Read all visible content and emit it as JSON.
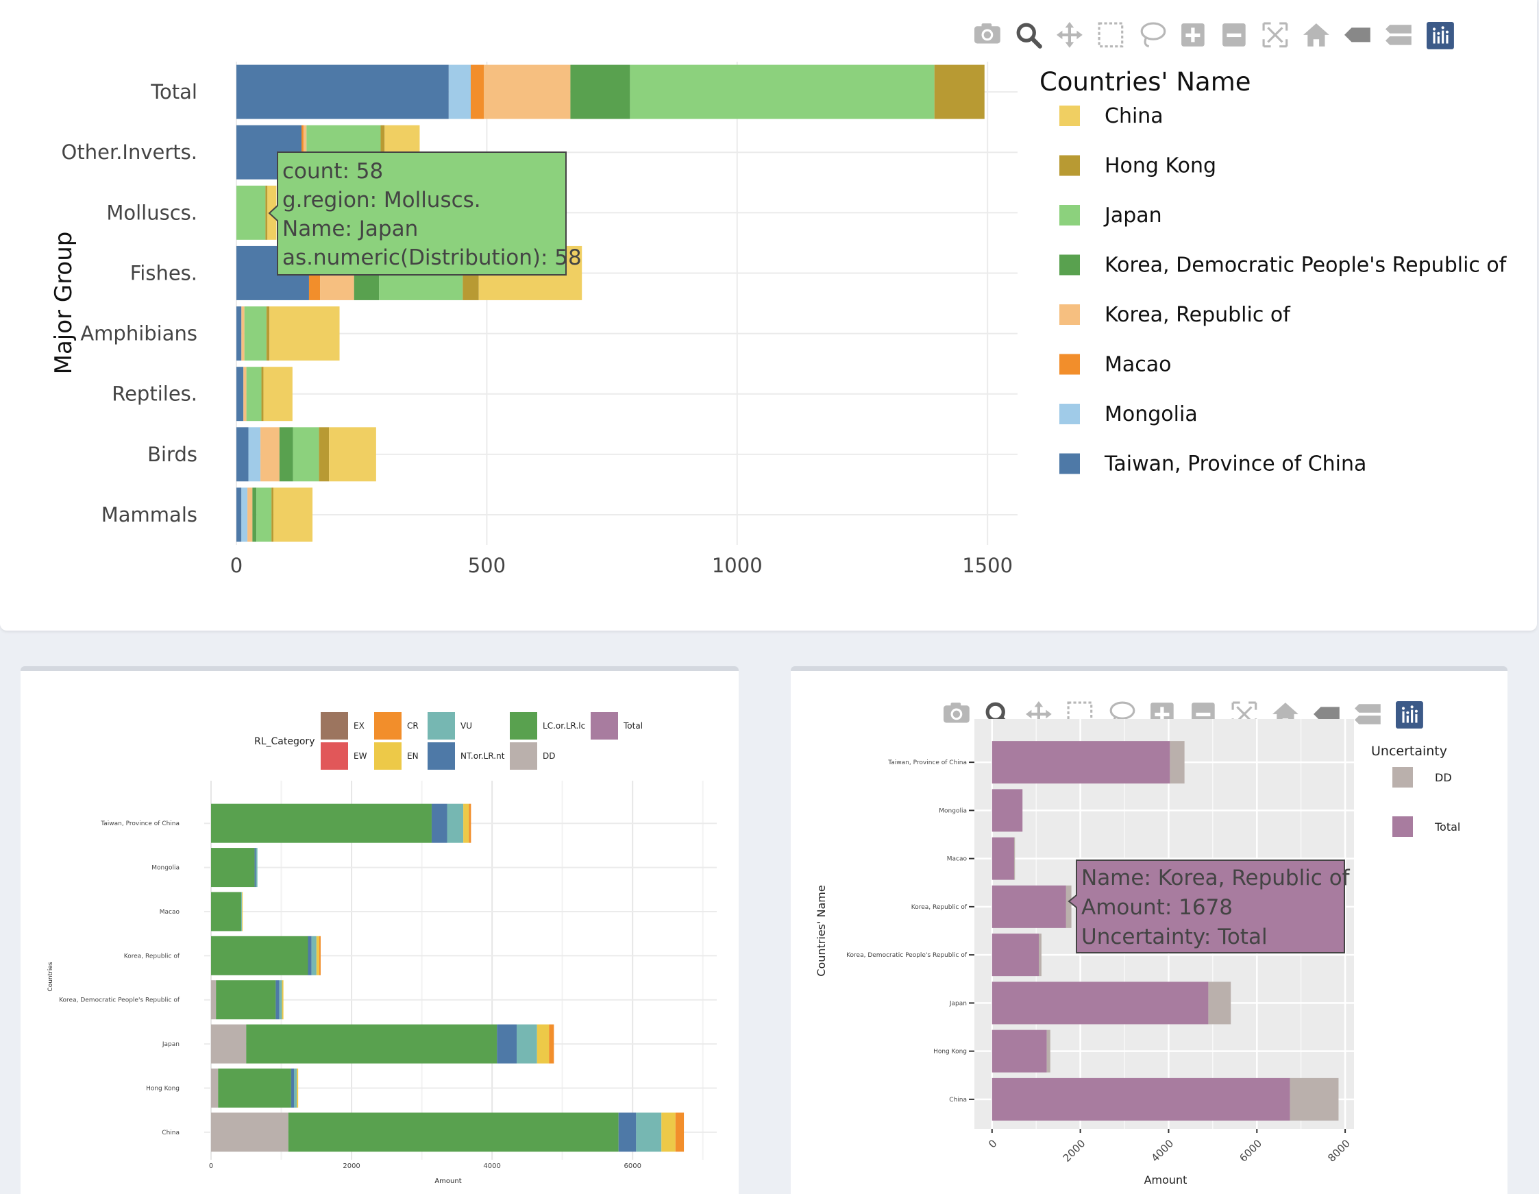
{
  "colors": {
    "China": "#f0cf62",
    "Hong Kong": "#b89a33",
    "Japan": "#8cd17d",
    "Korea, Democratic People's Republic of": "#59a14f",
    "Korea, Republic of": "#f6bf80",
    "Macao": "#f28e2b",
    "Mongolia": "#a0cbe8",
    "Taiwan, Province of China": "#4e79a7",
    "EX": "#9c755f",
    "EW": "#e15759",
    "CR": "#f28e2b",
    "EN": "#edc948",
    "VU": "#76b7b2",
    "NT.or.LR.nt": "#4e79a7",
    "LC.or.LR.lc": "#59a14f",
    "DD": "#bab0ac",
    "Total": "#a87c9f"
  },
  "toolbar_icons": [
    "camera-icon",
    "zoom-icon",
    "pan-icon",
    "box-select-icon",
    "lasso-icon",
    "zoom-in-icon",
    "zoom-out-icon",
    "autoscale-icon",
    "reset-axes-icon",
    "hover-closest-icon",
    "hover-compare-icon",
    "plotly-logo-icon"
  ],
  "chart_data": [
    {
      "type": "bar",
      "orientation": "horizontal",
      "stacked": true,
      "ylabel": "Major Group",
      "xlabel": "",
      "xlim": [
        0,
        1560
      ],
      "xticks": [
        0,
        500,
        1000,
        1500
      ],
      "categories": [
        "Total",
        "Other.Inverts.",
        "Molluscs.",
        "Fishes.",
        "Amphibians",
        "Reptiles.",
        "Birds",
        "Mammals"
      ],
      "legend": {
        "title": "Countries' Name",
        "position": "right"
      },
      "series": [
        {
          "name": "Taiwan, Province of China",
          "values": [
            424,
            130,
            0,
            145,
            10,
            14,
            24,
            10
          ]
        },
        {
          "name": "Mongolia",
          "values": [
            44,
            0,
            0,
            0,
            0,
            0,
            24,
            12
          ]
        },
        {
          "name": "Macao",
          "values": [
            26,
            4,
            0,
            22,
            0,
            0,
            0,
            0
          ]
        },
        {
          "name": "Korea, Republic of",
          "values": [
            173,
            6,
            0,
            68,
            6,
            6,
            38,
            10
          ]
        },
        {
          "name": "Korea, Democratic People's Republic of",
          "values": [
            119,
            0,
            0,
            50,
            0,
            0,
            27,
            8
          ]
        },
        {
          "name": "Japan",
          "values": [
            608,
            148,
            58,
            167,
            44,
            30,
            52,
            30
          ]
        },
        {
          "name": "Hong Kong",
          "values": [
            100,
            8,
            4,
            32,
            6,
            4,
            20,
            4
          ]
        },
        {
          "name": "China",
          "values": [
            0,
            70,
            18,
            206,
            140,
            58,
            94,
            78
          ]
        }
      ],
      "tooltip": {
        "lines": [
          "count:  58",
          "g.region: Molluscs.",
          "Name: Japan",
          "as.numeric(Distribution):  58"
        ]
      }
    },
    {
      "type": "bar",
      "orientation": "horizontal",
      "stacked": true,
      "xlabel": "Amount",
      "ylabel": "Countries",
      "xlim": [
        0,
        7100
      ],
      "xticks": [
        0,
        2000,
        4000,
        6000
      ],
      "categories": [
        "Taiwan, Province of China",
        "Mongolia",
        "Macao",
        "Korea, Republic of",
        "Korea, Democratic People's Republic of",
        "Japan",
        "Hong Kong",
        "China"
      ],
      "legend": {
        "title": "RL_Category",
        "position": "top"
      },
      "series": [
        {
          "name": "DD",
          "values": [
            0,
            0,
            0,
            0,
            70,
            500,
            100,
            1100
          ]
        },
        {
          "name": "LC.or.LR.lc",
          "values": [
            3140,
            620,
            430,
            1380,
            850,
            3570,
            1040,
            4700
          ]
        },
        {
          "name": "NT.or.LR.nt",
          "values": [
            220,
            20,
            0,
            50,
            50,
            280,
            40,
            250
          ]
        },
        {
          "name": "VU",
          "values": [
            230,
            20,
            10,
            70,
            40,
            290,
            40,
            360
          ]
        },
        {
          "name": "EN",
          "values": [
            80,
            0,
            10,
            40,
            20,
            170,
            20,
            200
          ]
        },
        {
          "name": "CR",
          "values": [
            30,
            0,
            0,
            20,
            0,
            70,
            0,
            120
          ]
        },
        {
          "name": "EW",
          "values": [
            0,
            0,
            0,
            0,
            0,
            0,
            0,
            0
          ]
        },
        {
          "name": "EX",
          "values": [
            0,
            0,
            0,
            0,
            0,
            0,
            0,
            0
          ]
        },
        {
          "name": "Total",
          "values": [
            0,
            0,
            0,
            0,
            0,
            0,
            0,
            0
          ]
        }
      ],
      "legend_order": [
        "EX",
        "EW",
        "CR",
        "EN",
        "VU",
        "NT.or.LR.nt",
        "LC.or.LR.lc",
        "DD",
        "Total"
      ]
    },
    {
      "type": "bar",
      "orientation": "horizontal",
      "stacked": true,
      "xlabel": "Amount",
      "ylabel": "Countries' Name",
      "xlim": [
        -400,
        8200
      ],
      "xticks": [
        0,
        2000,
        4000,
        6000,
        8000
      ],
      "categories": [
        "Taiwan, Province of China",
        "Mongolia",
        "Macao",
        "Korea, Republic of",
        "Korea, Democratic People's Republic of",
        "Japan",
        "Hong Kong",
        "China"
      ],
      "legend": {
        "title": "Uncertainty",
        "position": "right"
      },
      "series": [
        {
          "name": "Total",
          "values": [
            4030,
            690,
            500,
            1678,
            1060,
            4900,
            1240,
            6750
          ]
        },
        {
          "name": "DD",
          "values": [
            330,
            0,
            20,
            120,
            60,
            510,
            80,
            1100
          ]
        }
      ],
      "tooltip": {
        "lines": [
          "Name: Korea, Republic of",
          "Amount: 1678",
          "Uncertainty: Total"
        ]
      }
    }
  ]
}
